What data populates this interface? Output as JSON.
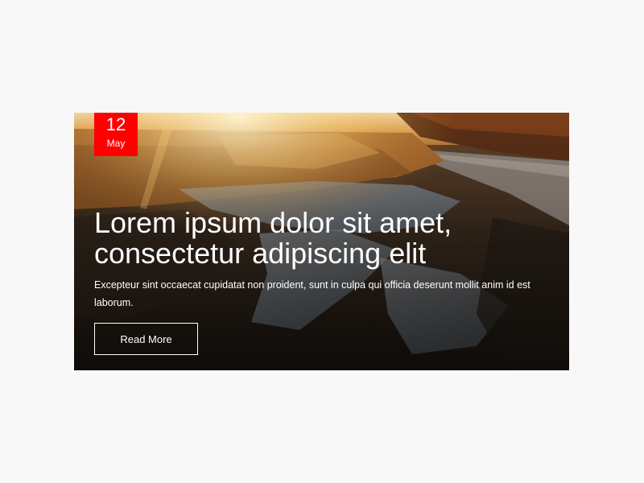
{
  "post": {
    "date": {
      "day": "12",
      "month": "May"
    },
    "title": "Lorem ipsum dolor sit amet, consectetur adipiscing elit",
    "excerpt": "Excepteur sint occaecat cupidatat non proident, sunt in culpa qui officia deserunt mollit anim id est laborum.",
    "button_label": "Read More"
  },
  "colors": {
    "badge": "#ff0000",
    "text": "#ffffff",
    "page_background": "#f8f8f8"
  }
}
